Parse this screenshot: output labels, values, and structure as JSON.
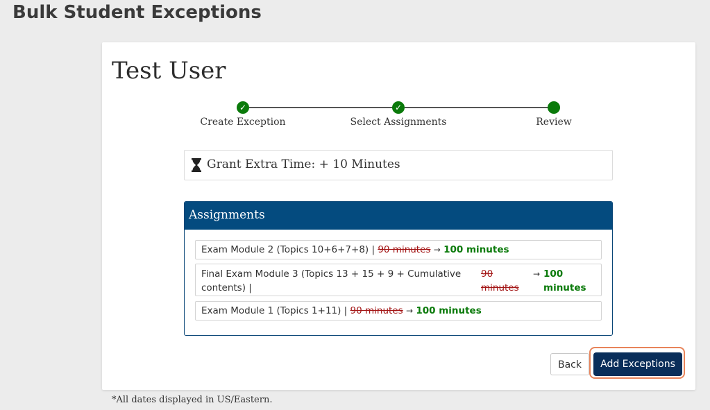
{
  "page": {
    "title": "Bulk Student Exceptions"
  },
  "card": {
    "user_name": "Test User",
    "steps": [
      {
        "label": "Create Exception",
        "status": "complete"
      },
      {
        "label": "Select Assignments",
        "status": "complete"
      },
      {
        "label": "Review",
        "status": "current"
      }
    ],
    "grant": {
      "icon": "hourglass-icon",
      "text": "Grant Extra Time: + 10 Minutes"
    },
    "assignments": {
      "header": "Assignments",
      "items": [
        {
          "name": "Exam Module 2 (Topics 10+6+7+8) |",
          "old": "90 minutes",
          "new": "100 minutes"
        },
        {
          "name": "Final Exam Module 3 (Topics 13 + 15 + 9 + Cumulative contents) |",
          "old": "90 minutes",
          "new": "100 minutes"
        },
        {
          "name": "Exam Module 1 (Topics 1+11) |",
          "old": "90 minutes",
          "new": "100 minutes"
        }
      ]
    },
    "buttons": {
      "back": "Back",
      "add": "Add Exceptions"
    }
  },
  "footnote": "*All dates displayed in US/Eastern.",
  "colors": {
    "accent": "#044b7f",
    "success": "#0a7a0a",
    "strike": "#a31515",
    "focus_ring": "#e8845a"
  }
}
